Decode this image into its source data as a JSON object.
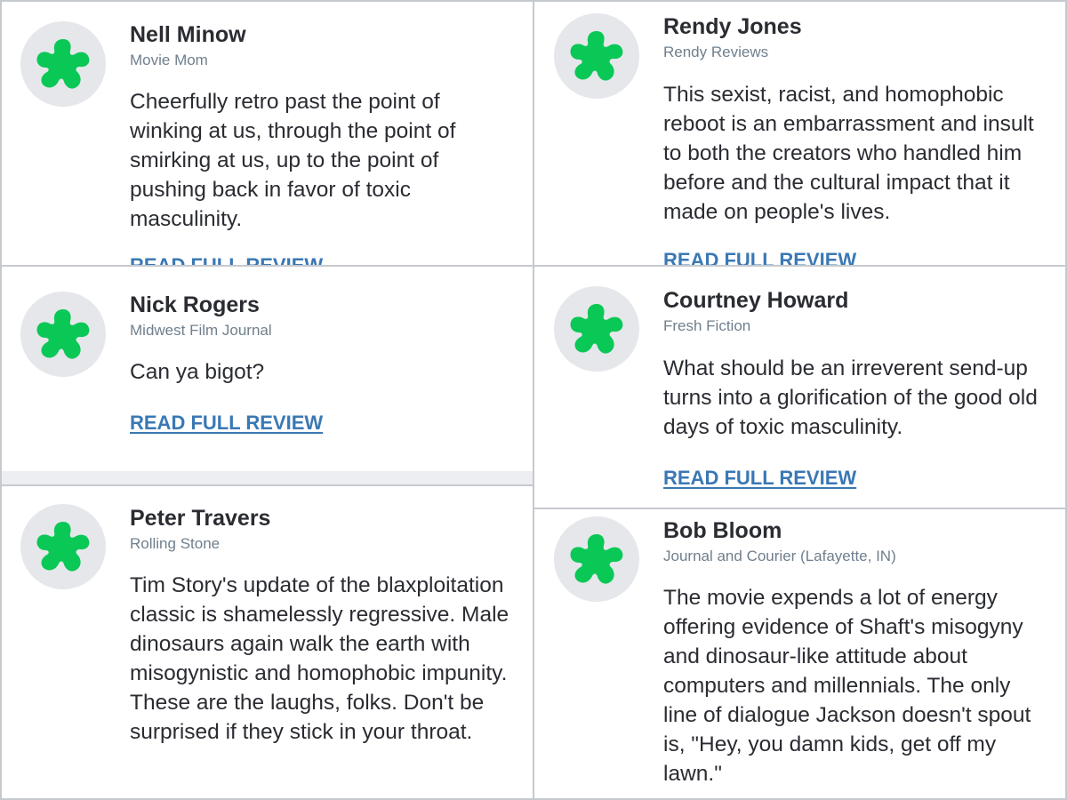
{
  "reviews": [
    {
      "critic": "Nell Minow",
      "publication": "Movie Mom",
      "quote": "Cheerfully retro past the point of winking at us, through the point of smirking at us, up to the point of pushing back in favor of toxic masculinity.",
      "link_label": "READ FULL REVIEW",
      "icon": "rotten-splat-icon"
    },
    {
      "critic": "Rendy Jones",
      "publication": "Rendy Reviews",
      "quote": "This sexist, racist, and homophobic reboot is an embarrassment and insult to both the creators who handled him before and the cultural impact that it made on people's lives.",
      "link_label": "READ FULL REVIEW",
      "icon": "rotten-splat-icon"
    },
    {
      "critic": "Nick Rogers",
      "publication": "Midwest Film Journal",
      "quote": "Can ya bigot?",
      "link_label": "READ FULL REVIEW",
      "icon": "rotten-splat-icon"
    },
    {
      "critic": "Courtney Howard",
      "publication": "Fresh Fiction",
      "quote": "What should be an irreverent send-up turns into a glorification of the good old days of toxic masculinity.",
      "link_label": "READ FULL REVIEW",
      "icon": "rotten-splat-icon"
    },
    {
      "critic": "Peter Travers",
      "publication": "Rolling Stone",
      "quote": "Tim Story's update of the blaxploitation classic is shamelessly regressive. Male dinosaurs again walk the earth with misogynistic and homophobic impunity. These are the laughs, folks. Don't be surprised if they stick in your throat.",
      "icon": "rotten-splat-icon"
    },
    {
      "critic": "Bob Bloom",
      "publication": "Journal and Courier (Lafayette, IN)",
      "quote": "The movie expends a lot of energy offering evidence of Shaft's misogyny and dinosaur-like attitude about computers and millennials. The only line of dialogue Jackson doesn't spout is, \"Hey, you damn kids, get off my lawn.\"",
      "icon": "rotten-splat-icon"
    }
  ],
  "colors": {
    "splat": "#0ac855",
    "avatar_bg": "#e5e7eb",
    "link": "#3a78b4",
    "text": "#2a2c32",
    "subtext": "#6f7f8d"
  }
}
